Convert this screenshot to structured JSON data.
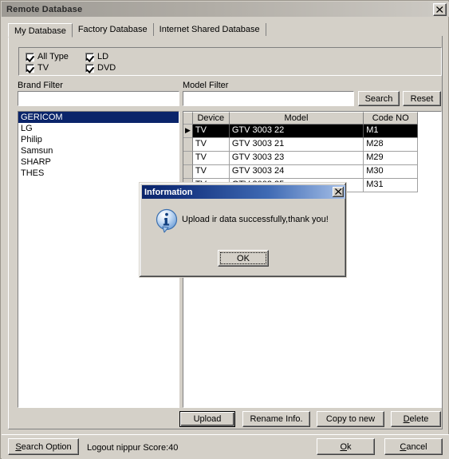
{
  "window": {
    "title": "Remote Database",
    "close_icon": "close-icon"
  },
  "tabs": [
    {
      "label": "My Database",
      "active": true
    },
    {
      "label": "Factory Database",
      "active": false
    },
    {
      "label": "Internet Shared Database",
      "active": false
    }
  ],
  "type_filter": {
    "checkboxes": [
      {
        "label": "All Type",
        "checked": true
      },
      {
        "label": "LD",
        "checked": true
      },
      {
        "label": "TV",
        "checked": true
      },
      {
        "label": "DVD",
        "checked": true
      }
    ]
  },
  "brand_filter": {
    "label": "Brand Filter",
    "input_value": "",
    "items": [
      {
        "label": "GERICOM",
        "selected": true
      },
      {
        "label": "LG",
        "selected": false
      },
      {
        "label": "Philip",
        "selected": false
      },
      {
        "label": "Samsun",
        "selected": false
      },
      {
        "label": "SHARP",
        "selected": false
      },
      {
        "label": "THES",
        "selected": false
      }
    ]
  },
  "model_filter": {
    "label": "Model Filter",
    "input_value": "",
    "search_label": "Search",
    "reset_label": "Reset"
  },
  "grid": {
    "columns": [
      "Device",
      "Model",
      "Code NO"
    ],
    "rows": [
      {
        "indicator": "▶",
        "device": "TV",
        "model": "GTV 3003 22",
        "code": "M1",
        "selected": true
      },
      {
        "indicator": "",
        "device": "TV",
        "model": "GTV 3003 21",
        "code": "M28",
        "selected": false
      },
      {
        "indicator": "",
        "device": "TV",
        "model": "GTV 3003 23",
        "code": "M29",
        "selected": false
      },
      {
        "indicator": "",
        "device": "TV",
        "model": "GTV 3003 24",
        "code": "M30",
        "selected": false
      },
      {
        "indicator": "",
        "device": "TV",
        "model": "GTV 3003 25",
        "code": "M31",
        "selected": false
      }
    ]
  },
  "action_buttons": {
    "upload": "Upload",
    "rename": "Rename Info.",
    "copy": "Copy to new",
    "delete_mnemonic": "D",
    "delete_rest": "elete"
  },
  "statusbar": {
    "search_option_mnemonic": "S",
    "search_option_rest": "earch Option",
    "status_text": "Logout nippur Score:40",
    "ok_mnemonic": "O",
    "ok_rest": "k",
    "cancel_mnemonic": "C",
    "cancel_rest": "ancel"
  },
  "dialog": {
    "title": "Information",
    "message": "Upload ir data successfully,thank you!",
    "ok_label": "OK",
    "icon": "info-icon",
    "close_icon": "close-icon",
    "title_color": "#0a246a"
  }
}
